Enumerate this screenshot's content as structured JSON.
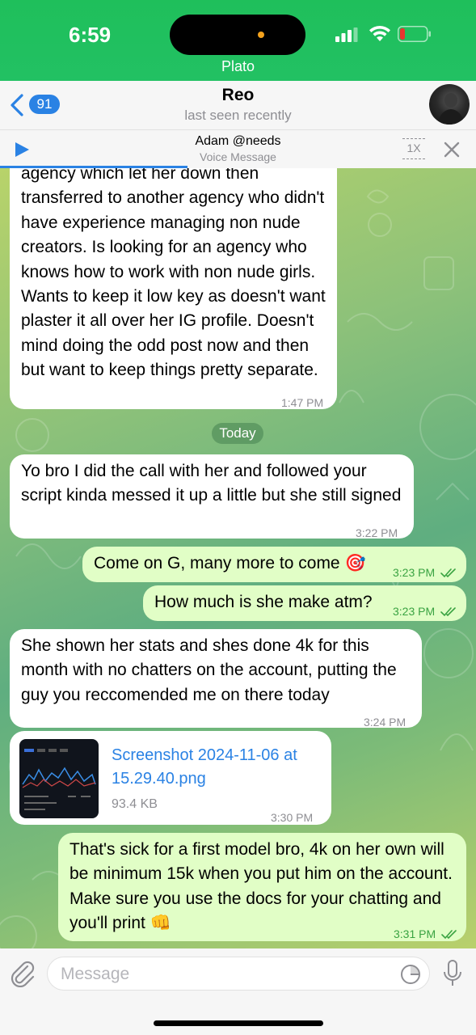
{
  "status_bar": {
    "time": "6:59",
    "call_label": "Plato",
    "battery_color": "#e8362f"
  },
  "header": {
    "back_count": "91",
    "name": "Reo",
    "status": "last seen recently"
  },
  "voice_bar": {
    "title": "Adam @needs",
    "subtitle": "Voice Message",
    "speed": "1X"
  },
  "messages": [
    {
      "direction": "in",
      "text": "agency which let her down then transferred to another agency who didn't have experience managing non nude creators. Is looking for an agency who knows how to work with non nude girls. Wants to keep it low key as doesn't want plaster it all over her IG profile.   Doesn't mind doing the odd post now and then but want to keep things pretty separate.",
      "time": "1:47 PM"
    },
    {
      "direction": "in",
      "text": "Yo bro I did the call with her and followed your script kinda messed it up a little but she still signed",
      "time": "3:22 PM"
    },
    {
      "direction": "out",
      "text": "Come on G, many more to come 🎯",
      "time": "3:23 PM"
    },
    {
      "direction": "out",
      "text": "How much is she make atm?",
      "time": "3:23 PM"
    },
    {
      "direction": "in",
      "text": "She shown her stats and shes done 4k for this month with no chatters on the account, putting the guy you reccomended me on there today",
      "time": "3:24 PM"
    },
    {
      "direction": "in",
      "type": "file",
      "file_name": "Screenshot 2024-11-06 at 15.29.40.png",
      "file_size": "93.4 KB",
      "time": "3:30 PM"
    },
    {
      "direction": "out",
      "text": "That's sick for a first model bro, 4k on her own will be minimum 15k when you put him on the account. Make sure you use the docs for your chatting and you'll print 👊",
      "time": "3:31 PM"
    }
  ],
  "date_divider": "Today",
  "input": {
    "placeholder": "Message"
  },
  "colors": {
    "accent": "#2a82e4",
    "outgoing_bubble": "#e1fec6",
    "incoming_bubble": "#ffffff",
    "status_green": "#22c163"
  }
}
